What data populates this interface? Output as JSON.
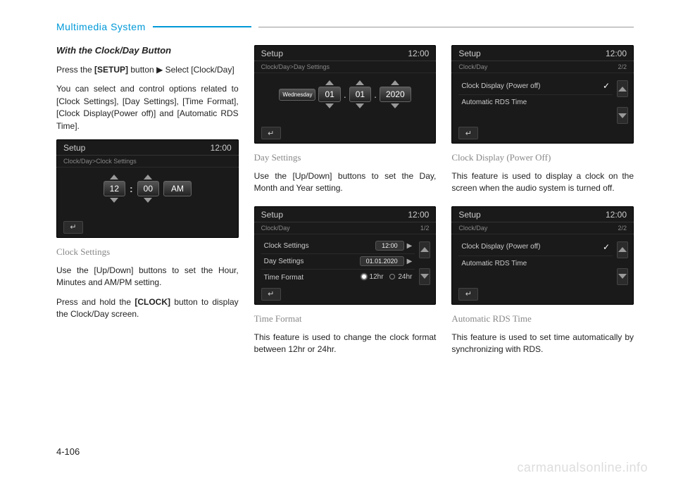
{
  "header": {
    "section": "Multimedia System"
  },
  "page_number": "4-106",
  "watermark": "carmanualsonline.info",
  "col1": {
    "heading": "With the Clock/Day Button",
    "p1a": "Press the ",
    "p1b": "[SETUP]",
    "p1c": " button ▶ Select [Clock/Day]",
    "p2": "You can select and control options related to [Clock Settings], [Day Settings], [Time Format], [Clock Display(Power off)] and [Automatic RDS Time].",
    "shot1": {
      "title": "Setup",
      "time": "12:00",
      "breadcrumb": "Clock/Day>Clock Settings",
      "hour": "12",
      "minute": "00",
      "ampm": "AM"
    },
    "caption1": "Clock Settings",
    "p3": "Use the [Up/Down] buttons to set the Hour, Minutes and AM/PM setting.",
    "p4a": "Press and hold the ",
    "p4b": "[CLOCK]",
    "p4c": " button to display the Clock/Day screen."
  },
  "col2": {
    "shot1": {
      "title": "Setup",
      "time": "12:00",
      "breadcrumb": "Clock/Day>Day Settings",
      "weekday": "Wednesday",
      "day": "01",
      "month": "01",
      "year": "2020"
    },
    "caption1": "Day Settings",
    "p1": "Use the [Up/Down] buttons to set the Day, Month and Year setting.",
    "shot2": {
      "title": "Setup",
      "time": "12:00",
      "breadcrumb": "Clock/Day",
      "page": "1/2",
      "row1": "Clock Settings",
      "row1v": "12:00",
      "row2": "Day Settings",
      "row2v": "01.01.2020",
      "row3": "Time Format",
      "row3a": "12hr",
      "row3b": "24hr"
    },
    "caption2": "Time Format",
    "p2": "This feature is used to change the clock format between 12hr or 24hr."
  },
  "col3": {
    "shot1": {
      "title": "Setup",
      "time": "12:00",
      "breadcrumb": "Clock/Day",
      "page": "2/2",
      "row1": "Clock Display (Power off)",
      "row2": "Automatic RDS Time"
    },
    "caption1": "Clock Display (Power Off)",
    "p1": "This feature is used to display a clock on the screen when the audio system is turned off.",
    "shot2": {
      "title": "Setup",
      "time": "12:00",
      "breadcrumb": "Clock/Day",
      "page": "2/2",
      "row1": "Clock Display (Power off)",
      "row2": "Automatic RDS Time"
    },
    "caption2": "Automatic RDS Time",
    "p2": "This feature is used to set time automatically by synchronizing with RDS."
  }
}
